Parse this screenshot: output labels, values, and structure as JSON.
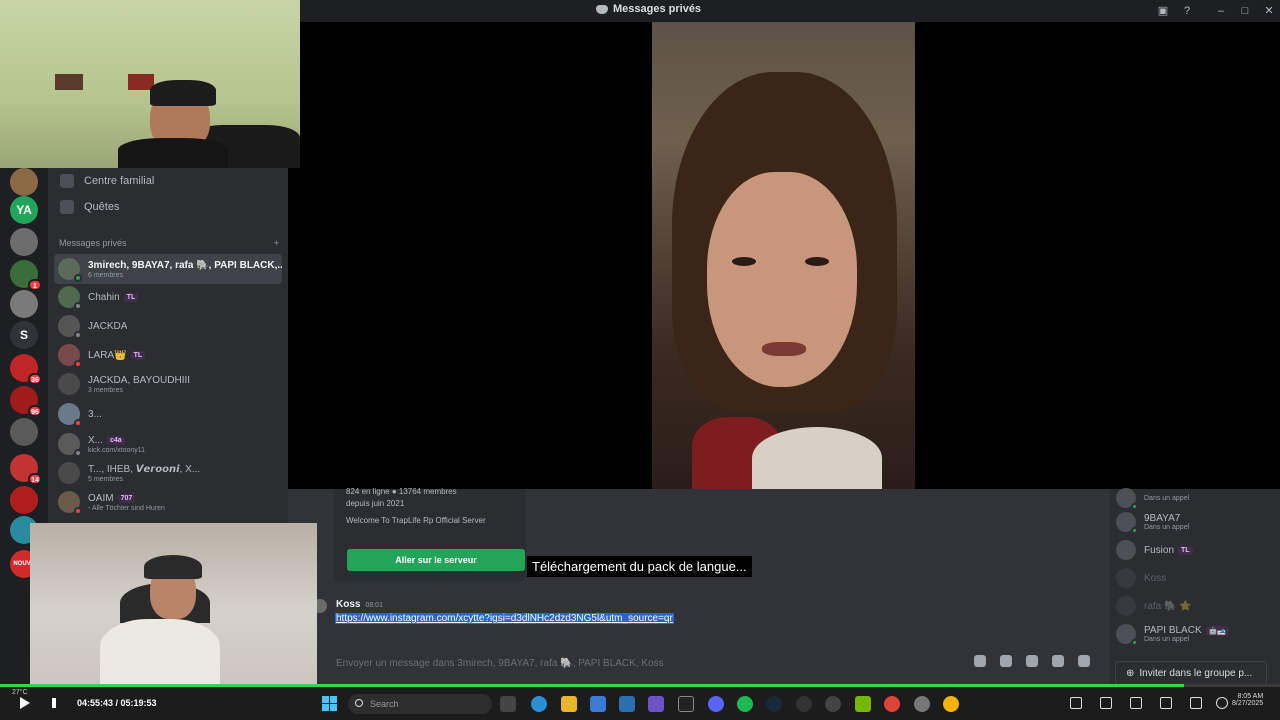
{
  "window": {
    "title": "Messages privés"
  },
  "sidebar": {
    "nav": [
      {
        "label": "Centre familial"
      },
      {
        "label": "Quêtes"
      }
    ],
    "dm_header": "Messages privés",
    "dm_add": "+",
    "dms": [
      {
        "name": "3mirech, 9BAYA7, rafa 🐘, PAPI BLACK,...",
        "sub": "6 membres",
        "active": true,
        "status": "#23a559"
      },
      {
        "name": "Chahin",
        "tag": "TL",
        "sub": "",
        "status": "#80848e"
      },
      {
        "name": "JACKDA",
        "sub": "",
        "status": "#80848e"
      },
      {
        "name": "LARA👑",
        "tag": "TL",
        "sub": "",
        "status": "#f23f43"
      },
      {
        "name": "JACKDA, BAYOUDHIII",
        "sub": "3 membres",
        "status": ""
      },
      {
        "name": "3...",
        "sub": "",
        "status": "#f23f43"
      },
      {
        "name": "X...",
        "tag": "c4a",
        "sub": "kick.com/xtoony11",
        "status": "#80848e"
      },
      {
        "name": "T..., IHEB, 𝙑𝙚𝙧𝙤𝙤𝙣𝙞, X...",
        "sub": "5 membres",
        "status": ""
      },
      {
        "name": "OAIM",
        "tag": "707",
        "sub": "- Alle Töchter sind Huren",
        "status": "#f23f43"
      }
    ]
  },
  "rail": {
    "servers": [
      {
        "color": "#8a6a45",
        "badge": ""
      },
      {
        "color": "#23a559",
        "letter": "YA",
        "badge": ""
      },
      {
        "color": "#6d6d6d",
        "badge": ""
      },
      {
        "color": "#3a6d3a",
        "badge": "1"
      },
      {
        "color": "#7a7a7a",
        "badge": ""
      },
      {
        "color": "#313338",
        "letter": "S",
        "badge": ""
      },
      {
        "color": "#c02626",
        "badge": "36"
      },
      {
        "color": "#a01c1c",
        "badge": "96"
      },
      {
        "color": "#5a5a5a",
        "badge": ""
      },
      {
        "color": "#c23434",
        "badge": "14"
      },
      {
        "color": "#b01e1e",
        "badge": ""
      },
      {
        "color": "#2a8aa0",
        "badge": ""
      },
      {
        "color": "#d12a2a",
        "letter": "NOUVE",
        "badge": ""
      }
    ]
  },
  "chat": {
    "card": {
      "online_members": "824 en ligne  ●  13764 membres",
      "since": "depuis juin 2021",
      "welcome": "Welcome To TrapLife Rp Official Server",
      "join_button": "Aller sur le serveur"
    },
    "message": {
      "author": "Koss",
      "time": "08:01",
      "link": "https://www.instagram.com/xcytte?igsi=d3dlNHc2dzd3NG5l&utm_source=qr"
    },
    "composer_placeholder": "Envoyer un message dans 3mirech, 9BAYA7, rafa 🐘, PAPI BLACK, Koss",
    "toast": "Téléchargement du pack de langue..."
  },
  "members": {
    "list": [
      {
        "name": "",
        "status": "Dans un appel",
        "dim": false
      },
      {
        "name": "9BAYA7",
        "status": "Dans un appel",
        "dim": false
      },
      {
        "name": "Fusion",
        "tag": "TL",
        "status": "",
        "dim": false
      },
      {
        "name": "Koss",
        "status": "",
        "dim": true
      },
      {
        "name": "rafa 🐘 ⭐",
        "status": "",
        "dim": true
      },
      {
        "name": "PAPI BLACK",
        "tag": "🤖🎿",
        "status": "Dans un appel",
        "dim": false
      }
    ],
    "invite_button": "Inviter dans le groupe p..."
  },
  "player": {
    "timecode": "04:55:43 / 05:19:53",
    "progress": 0.925,
    "weather": "27°C",
    "search_placeholder": "Search",
    "clock_time": "8:05 AM",
    "clock_date": "8/27/2025"
  },
  "colors": {
    "accent_green": "#23a559",
    "link_highlight": "#2d61d6",
    "progress": "#39d353"
  }
}
